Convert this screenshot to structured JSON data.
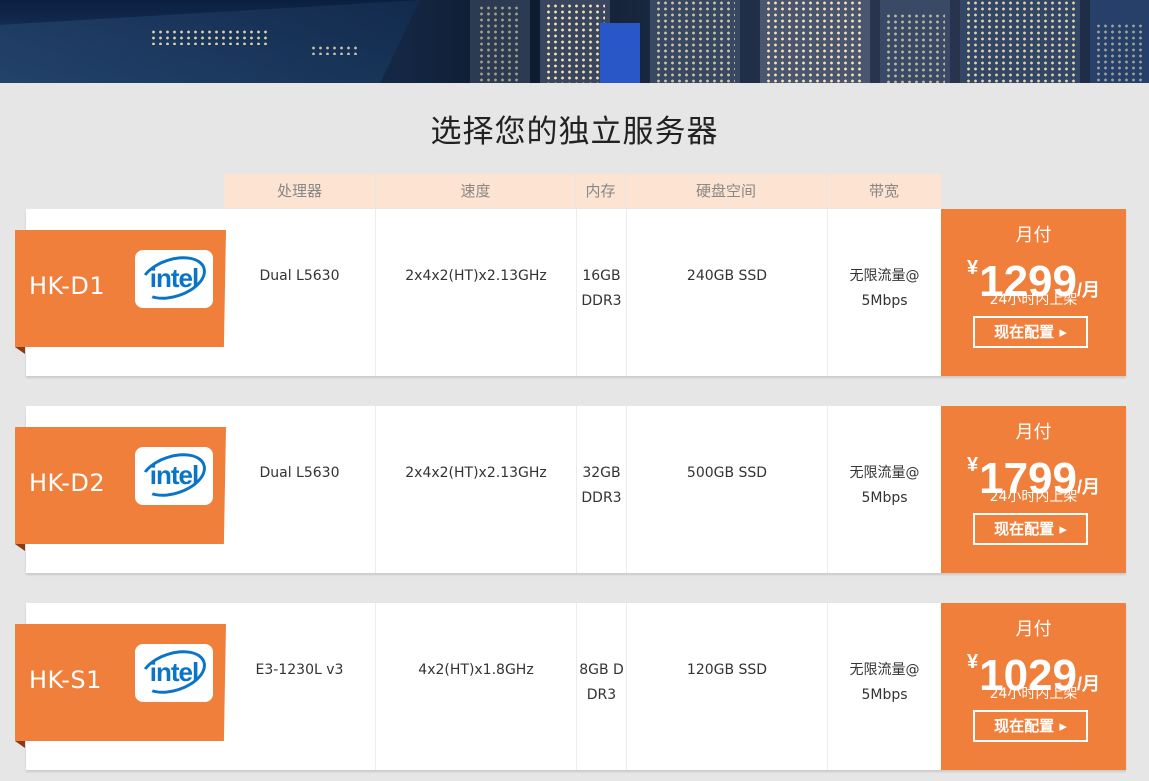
{
  "page": {
    "title": "选择您的独立服务器"
  },
  "columns": [
    "处理器",
    "速度",
    "内存",
    "硬盘空间",
    "带宽"
  ],
  "plans": [
    {
      "name": "HK-D1",
      "cpu": "Dual L5630",
      "speed": "2x4x2(HT)x2.13GHz",
      "memory_line1": "16GB",
      "memory_line2": "DDR3",
      "disk": "240GB SSD",
      "bandwidth_line1": "无限流量@",
      "bandwidth_line2": "5Mbps",
      "billing": "月付",
      "currency": "¥",
      "price": "1299",
      "unit": "/月",
      "note": "24小时内上架",
      "button": "现在配置 ▸",
      "logo": "intel"
    },
    {
      "name": "HK-D2",
      "cpu": "Dual L5630",
      "speed": "2x4x2(HT)x2.13GHz",
      "memory_line1": "32GB",
      "memory_line2": "DDR3",
      "disk": "500GB SSD",
      "bandwidth_line1": "无限流量@",
      "bandwidth_line2": "5Mbps",
      "billing": "月付",
      "currency": "¥",
      "price": "1799",
      "unit": "/月",
      "note": "24小时内上架",
      "button": "现在配置 ▸",
      "logo": "intel"
    },
    {
      "name": "HK-S1",
      "cpu": "E3-1230L v3",
      "speed": "4x2(HT)x1.8GHz",
      "memory_line1": "8GB D",
      "memory_line2": "DR3",
      "disk": "120GB SSD",
      "bandwidth_line1": "无限流量@",
      "bandwidth_line2": "5Mbps",
      "billing": "月付",
      "currency": "¥",
      "price": "1029",
      "unit": "/月",
      "note": "24小时内上架",
      "button": "现在配置 ▸",
      "logo": "intel"
    }
  ],
  "colors": {
    "accent": "#ef7f3a",
    "header_bg": "#fde3d1",
    "page_bg": "#e6e6e6"
  }
}
